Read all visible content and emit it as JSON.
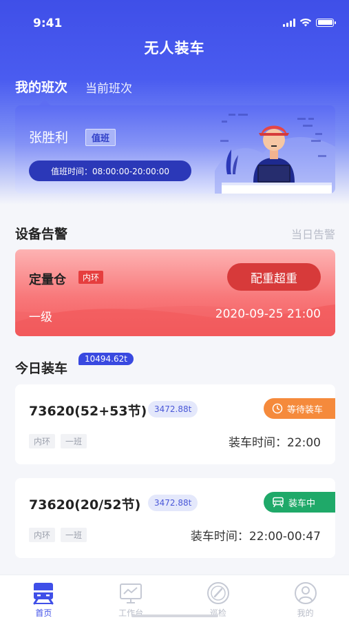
{
  "status_bar": {
    "time": "9:41"
  },
  "app": {
    "title": "无人装车"
  },
  "tabs": [
    {
      "label": "我的班次",
      "active": true
    },
    {
      "label": "当前班次",
      "active": false
    }
  ],
  "duty": {
    "name": "张胜利",
    "badge": "值班",
    "time_label": "值班时间：08:00:00-20:00:00"
  },
  "alerts_section": {
    "title": "设备告警",
    "link": "当日告警"
  },
  "alert": {
    "name": "定量仓",
    "tag": "内环",
    "action": "配重超重",
    "level": "一级",
    "time": "2020-09-25 21:00"
  },
  "loading_section": {
    "title": "今日装车",
    "total": "10494.62t"
  },
  "loads": [
    {
      "title": "73620(52+53节)",
      "weight": "3472.88t",
      "status": "等待装车",
      "status_color": "#f58a3c",
      "status_icon": "clock-icon",
      "tags": [
        "内环",
        "一班"
      ],
      "time": "装车时间：22:00"
    },
    {
      "title": "73620(20/52节)",
      "weight": "3472.88t",
      "status": "装车中",
      "status_color": "#1fa969",
      "status_icon": "train-icon",
      "tags": [
        "内环",
        "一班"
      ],
      "time": "装车时间：22:00-00:47"
    }
  ],
  "nav": [
    {
      "label": "首页",
      "icon": "train-icon",
      "active": true
    },
    {
      "label": "工作台",
      "icon": "monitor-icon",
      "active": false
    },
    {
      "label": "巡检",
      "icon": "gauge-icon",
      "active": false
    },
    {
      "label": "我的",
      "icon": "user-icon",
      "active": false
    }
  ]
}
